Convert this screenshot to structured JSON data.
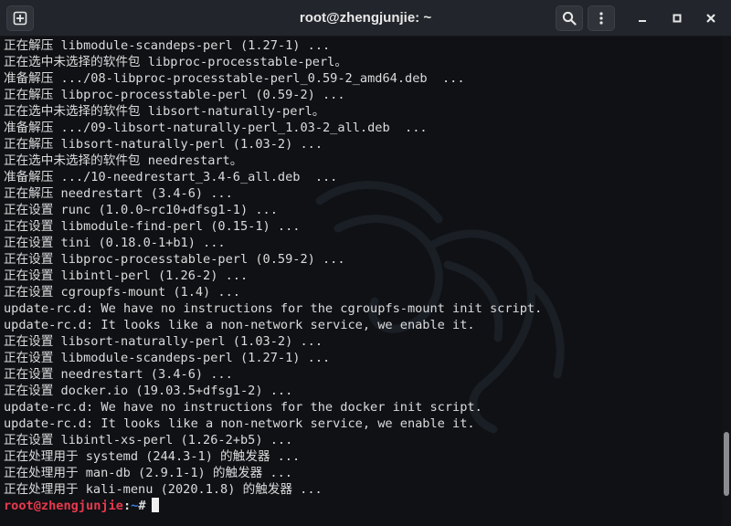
{
  "window": {
    "title": "root@zhengjunjie: ~"
  },
  "icons": {
    "new_tab": "new-tab-icon",
    "search": "search-icon",
    "menu": "kebab-menu-icon",
    "minimize": "minimize-icon",
    "maximize": "maximize-icon",
    "close": "close-icon",
    "watermark": "kali-dragon-icon"
  },
  "colors": {
    "background": "#0f1115",
    "text": "#dcdcdc",
    "prompt_user": "#e8394d",
    "prompt_path": "#3e7fe0"
  },
  "terminal": {
    "lines": [
      "正在解压 libmodule-scandeps-perl (1.27-1) ...",
      "正在选中未选择的软件包 libproc-processtable-perl。",
      "准备解压 .../08-libproc-processtable-perl_0.59-2_amd64.deb  ...",
      "正在解压 libproc-processtable-perl (0.59-2) ...",
      "正在选中未选择的软件包 libsort-naturally-perl。",
      "准备解压 .../09-libsort-naturally-perl_1.03-2_all.deb  ...",
      "正在解压 libsort-naturally-perl (1.03-2) ...",
      "正在选中未选择的软件包 needrestart。",
      "准备解压 .../10-needrestart_3.4-6_all.deb  ...",
      "正在解压 needrestart (3.4-6) ...",
      "正在设置 runc (1.0.0~rc10+dfsg1-1) ...",
      "正在设置 libmodule-find-perl (0.15-1) ...",
      "正在设置 tini (0.18.0-1+b1) ...",
      "正在设置 libproc-processtable-perl (0.59-2) ...",
      "正在设置 libintl-perl (1.26-2) ...",
      "正在设置 cgroupfs-mount (1.4) ...",
      "update-rc.d: We have no instructions for the cgroupfs-mount init script.",
      "update-rc.d: It looks like a non-network service, we enable it.",
      "正在设置 libsort-naturally-perl (1.03-2) ...",
      "正在设置 libmodule-scandeps-perl (1.27-1) ...",
      "正在设置 needrestart (3.4-6) ...",
      "正在设置 docker.io (19.03.5+dfsg1-2) ...",
      "update-rc.d: We have no instructions for the docker init script.",
      "update-rc.d: It looks like a non-network service, we enable it.",
      "正在设置 libintl-xs-perl (1.26-2+b5) ...",
      "正在处理用于 systemd (244.3-1) 的触发器 ...",
      "正在处理用于 man-db (2.9.1-1) 的触发器 ...",
      "正在处理用于 kali-menu (2020.1.8) 的触发器 ..."
    ],
    "prompt": {
      "user_host": "root@zhengjunjie",
      "colon": ":",
      "path": "~",
      "symbol": "#"
    }
  },
  "scrollbar": {
    "position_fraction": 0.93,
    "visible_fraction": 0.13
  }
}
